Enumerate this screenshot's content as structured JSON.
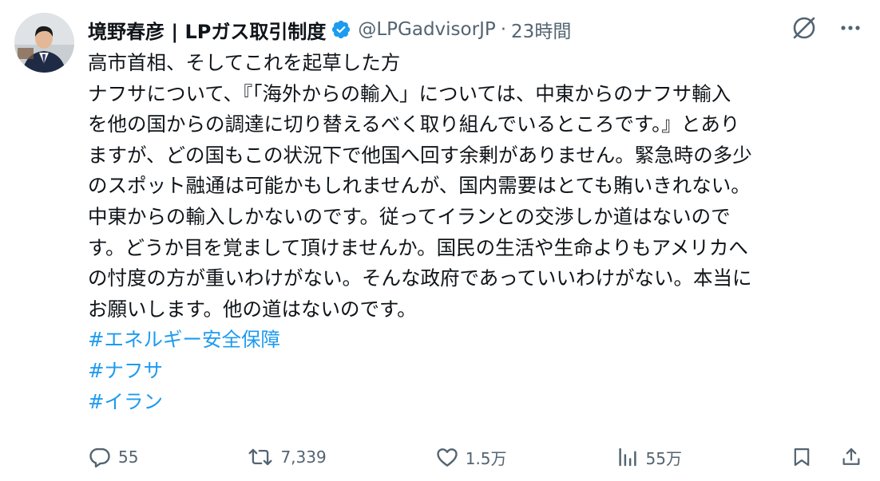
{
  "author": {
    "name": "境野春彦 | LPガス取引制度",
    "handle": "@LPGadvisorJP",
    "separator": "·",
    "time": "23時間"
  },
  "post": {
    "lines": [
      "高市首相、そしてこれを起草した方",
      "ナフサについて、『「海外からの輸入」については、中東からのナフサ輸入",
      "を他の国からの調達に切り替えるべく取り組んでいるところです。』とあり",
      "ますが、どの国もこの状況下で他国へ回す余剰がありません。緊急時の多少",
      "のスポット融通は可能かもしれませんが、国内需要はとても賄いきれない。",
      "中東からの輸入しかないのです。従ってイランとの交渉しか道はないので",
      "す。どうか目を覚まして頂けませんか。国民の生活や生命よりもアメリカへ",
      "の忖度の方が重いわけがない。そんな政府であっていいわけがない。本当に",
      "お願いします。他の道はないのです。"
    ],
    "hashtags": [
      "#エネルギー安全保障",
      "#ナフサ",
      "#イラン"
    ]
  },
  "engagement": {
    "replies": "55",
    "reposts": "7,339",
    "likes": "1.5万",
    "views": "55万"
  },
  "icons": {
    "avatar": "profile-photo",
    "verified": "verified-badge-icon",
    "grok": "grok-icon",
    "more": "more-icon",
    "reply": "reply-icon",
    "repost": "repost-icon",
    "like": "heart-icon",
    "views": "views-icon",
    "bookmark": "bookmark-icon",
    "share": "share-icon"
  },
  "colors": {
    "text": "#0f1419",
    "secondary": "#536471",
    "link": "#1d9bf0",
    "verified": "#1d9bf0"
  }
}
